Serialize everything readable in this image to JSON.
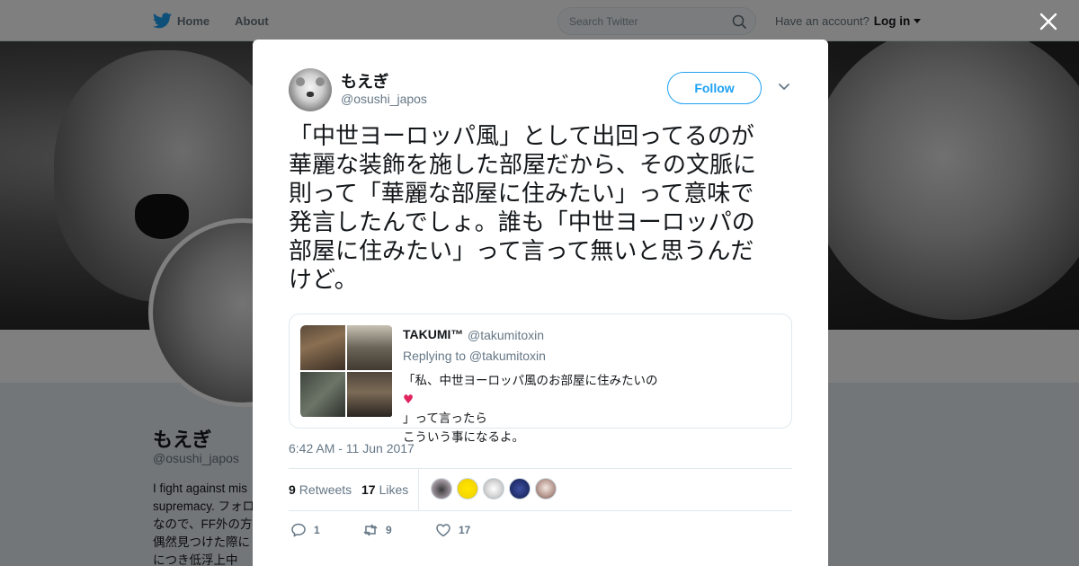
{
  "nav": {
    "home_label": "Home",
    "about_label": "About",
    "search_placeholder": "Search Twitter",
    "account_prompt": "Have an account?",
    "login_label": "Log in",
    "brand_color": "#1da1f2"
  },
  "background_profile": {
    "display_name": "もえぎ",
    "handle": "@osushi_japos",
    "bio_lines": [
      "I fight against mis",
      "supremacy. フォロ",
      "なので、FF外の方",
      "偶然見つけた際に",
      "につき低浮上中"
    ]
  },
  "tweet": {
    "author_name": "もえぎ",
    "author_handle": "@osushi_japos",
    "follow_label": "Follow",
    "text_lines": [
      "「中世ヨーロッパ風」として出回ってるのが",
      "華麗な装飾を施した部屋だから、その文脈に",
      "則って「華麗な部屋に住みたい」って意味で",
      "発言したんでしょ。誰も「中世ヨーロッパの",
      "部屋に住みたい」って言って無いと思うんだ",
      "けど。"
    ],
    "quoted": {
      "author_name": "TAKUMI™",
      "author_handle": "@takumitoxin",
      "reply_context": "Replying to @takumitoxin",
      "text_line1_before": "「私、中世ヨーロッパ風のお部屋に住みたいの",
      "text_line1_heart": "♥",
      "text_line1_after": "」って言ったら",
      "text_line2": "こういう事になるよ。"
    },
    "timestamp": "6:42 AM - 11 Jun 2017",
    "retweets_count": "9",
    "retweets_label": "Retweets",
    "likes_count": "17",
    "likes_label": "Likes",
    "reply_count": "1",
    "retweet_action_count": "9",
    "like_action_count": "17"
  }
}
